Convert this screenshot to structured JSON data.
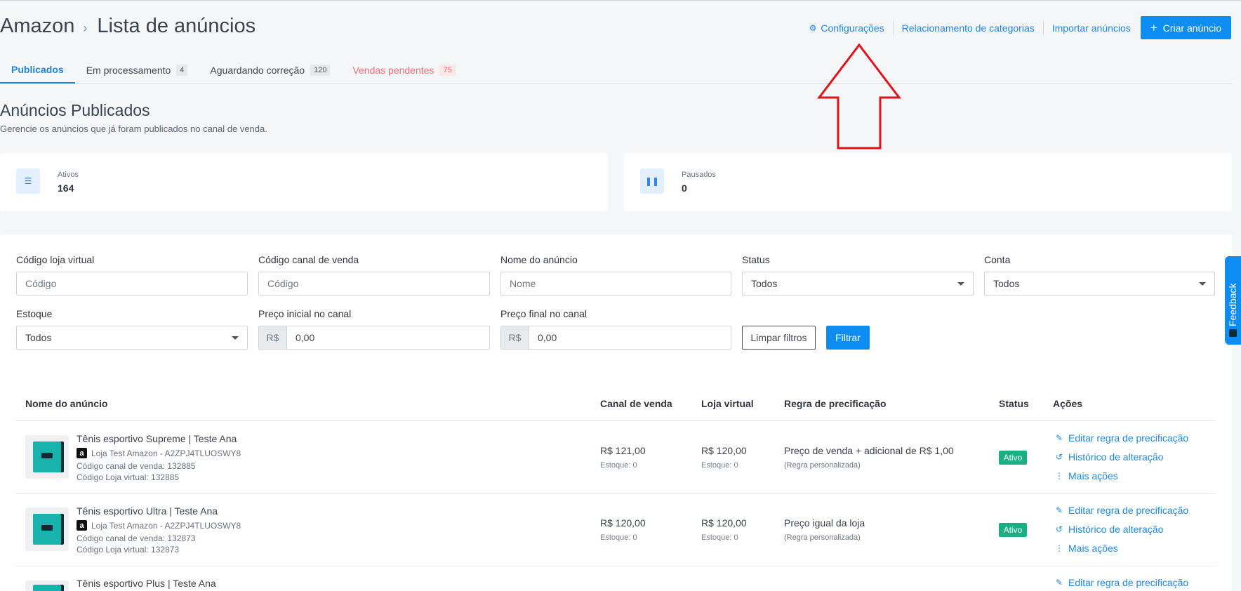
{
  "breadcrumb": {
    "root": "Amazon",
    "separator": "›",
    "current": "Lista de anúncios"
  },
  "top_actions": {
    "settings": "Configurações",
    "category_mapping": "Relacionamento de categorias",
    "import": "Importar anúncios",
    "create": "Criar anúncio",
    "create_icon": "+"
  },
  "tabs": [
    {
      "label": "Publicados",
      "count": ""
    },
    {
      "label": "Em processamento",
      "count": "4"
    },
    {
      "label": "Aguardando correção",
      "count": "120"
    },
    {
      "label": "Vendas pendentes",
      "count": "75"
    }
  ],
  "section": {
    "title": "Anúncios Publicados",
    "subtitle": "Gerencie os anúncios que já foram publicados no canal de venda."
  },
  "summary": {
    "active": {
      "label": "Ativos",
      "value": "164"
    },
    "paused": {
      "label": "Pausados",
      "value": "0"
    }
  },
  "filters": {
    "store_code": {
      "label": "Código loja virtual",
      "placeholder": "Código"
    },
    "channel_code": {
      "label": "Código canal de venda",
      "placeholder": "Código"
    },
    "ad_name": {
      "label": "Nome do anúncio",
      "placeholder": "Nome"
    },
    "status": {
      "label": "Status",
      "value": "Todos"
    },
    "account": {
      "label": "Conta",
      "value": "Todos"
    },
    "stock": {
      "label": "Estoque",
      "value": "Todos"
    },
    "price_start": {
      "label": "Preço inicial no canal",
      "prefix": "R$",
      "value": "0,00"
    },
    "price_end": {
      "label": "Preço final no canal",
      "prefix": "R$",
      "value": "0,00"
    },
    "clear": "Limpar filtros",
    "apply": "Filtrar"
  },
  "table": {
    "headers": {
      "name": "Nome do anúncio",
      "channel": "Canal de venda",
      "store": "Loja virtual",
      "rule": "Regra de precificação",
      "status": "Status",
      "actions": "Ações"
    },
    "rows": [
      {
        "name": "Tênis esportivo Supreme | Teste Ana",
        "store_line": "Loja Test Amazon - A2ZPJ4TLUOSWY8",
        "channel_code": "Código canal de venda: 132885",
        "store_code": "Código Loja virtual: 132885",
        "channel_price": "R$ 121,00",
        "channel_stock": "Estoque: 0",
        "store_price": "R$ 120,00",
        "store_stock": "Estoque: 0",
        "rule": "Preço de venda + adicional de R$ 1,00",
        "rule_note": "(Regra personalizada)",
        "status": "Ativo",
        "actions": [
          "Editar regra de precificação",
          "Histórico de alteração",
          "Mais ações"
        ]
      },
      {
        "name": "Tênis esportivo Ultra | Teste Ana",
        "store_line": "Loja Test Amazon - A2ZPJ4TLUOSWY8",
        "channel_code": "Código canal de venda: 132873",
        "store_code": "Código Loja virtual: 132873",
        "channel_price": "R$ 120,00",
        "channel_stock": "Estoque: 0",
        "store_price": "R$ 120,00",
        "store_stock": "Estoque: 0",
        "rule": "Preço igual da loja",
        "rule_note": "(Regra personalizada)",
        "status": "Ativo",
        "actions": [
          "Editar regra de precificação",
          "Histórico de alteração",
          "Mais ações"
        ]
      },
      {
        "name": "Tênis esportivo Plus | Teste Ana",
        "actions": [
          "Editar regra de precificação"
        ]
      }
    ]
  },
  "store_logo_letter": "a",
  "feedback": "Feedback",
  "colors": {
    "primary": "#0d8df2",
    "link": "#1e86e0",
    "success": "#1cae83",
    "alert": "#ee6e73",
    "annotation": "#e0131a"
  },
  "icons": {
    "settings": "gear-icon",
    "active": "list-icon",
    "paused": "pause-icon",
    "edit": "edit-icon",
    "history": "history-icon",
    "more": "more-vertical-icon"
  }
}
